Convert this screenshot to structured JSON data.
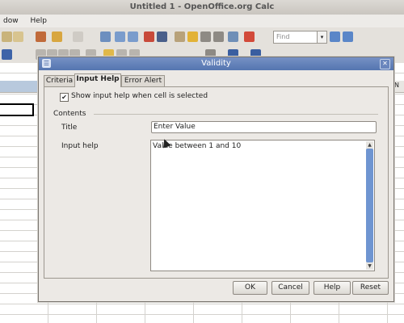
{
  "window": {
    "title": "Untitled 1 - OpenOffice.org Calc"
  },
  "menubar": {
    "items": [
      "dow",
      "Help"
    ]
  },
  "toolbar": {
    "find_placeholder": "Find"
  },
  "sheet": {
    "visible_column_label": "N"
  },
  "dialog": {
    "title": "Validity",
    "tabs": [
      {
        "label": "Criteria",
        "active": false
      },
      {
        "label": "Input Help",
        "active": true
      },
      {
        "label": "Error Alert",
        "active": false
      }
    ],
    "show_input_help_label": "Show input help when cell is selected",
    "show_input_help_checked": true,
    "contents_label": "Contents",
    "title_label": "Title",
    "title_value": "Enter Value",
    "input_help_label": "Input help",
    "input_help_value": "Value between 1 and 10",
    "buttons": {
      "ok": "OK",
      "cancel": "Cancel",
      "help": "Help",
      "reset": "Reset"
    }
  },
  "colors": {
    "dialog_titlebar": "#5f7db8",
    "scroll_thumb": "#6f95d1"
  }
}
